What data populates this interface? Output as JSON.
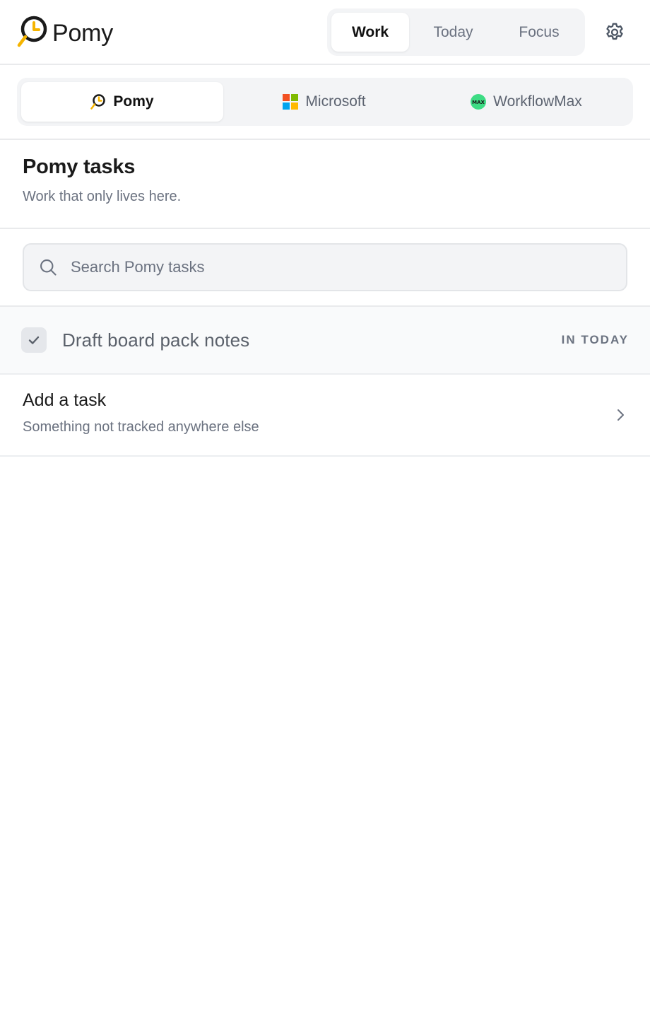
{
  "app": {
    "name": "Pomy"
  },
  "header": {
    "view_tabs": [
      {
        "label": "Work",
        "active": true
      },
      {
        "label": "Today",
        "active": false
      },
      {
        "label": "Focus",
        "active": false
      }
    ],
    "settings_icon": "gear-icon"
  },
  "sources": {
    "tabs": [
      {
        "label": "Pomy",
        "icon": "pomy-logo-icon",
        "active": true
      },
      {
        "label": "Microsoft",
        "icon": "microsoft-logo-icon",
        "active": false
      },
      {
        "label": "WorkflowMax",
        "icon": "workflowmax-logo-icon",
        "icon_text": "MAX",
        "active": false
      }
    ]
  },
  "section": {
    "title": "Pomy tasks",
    "subtitle": "Work that only lives here."
  },
  "search": {
    "placeholder": "Search Pomy tasks",
    "value": ""
  },
  "tasks": [
    {
      "label": "Draft board pack notes",
      "checked": true,
      "status": "IN TODAY"
    }
  ],
  "add_task": {
    "title": "Add a task",
    "subtitle": "Something not tracked anywhere else"
  },
  "colors": {
    "brand_yellow": "#f5b400",
    "ms_red": "#f25022",
    "ms_green": "#7fba00",
    "ms_blue": "#00a4ef",
    "ms_yellow": "#ffb900",
    "wfm_green": "#3ddc84"
  }
}
